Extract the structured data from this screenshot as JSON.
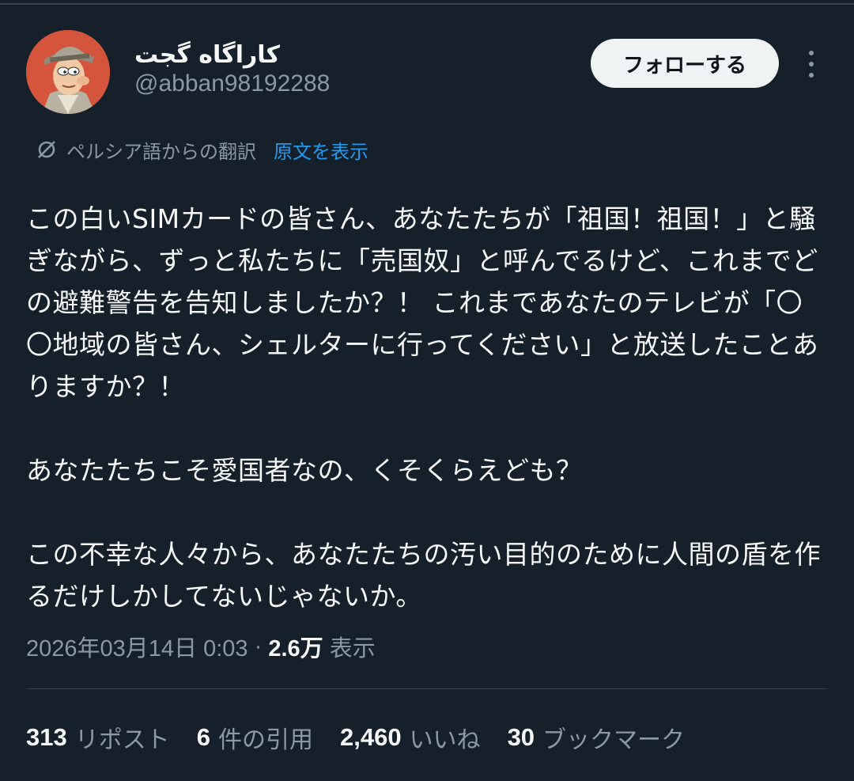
{
  "author": {
    "name": "کاراگاه گجت",
    "handle": "@abban98192288"
  },
  "follow_button_label": "フォローする",
  "translation": {
    "label": "ペルシア語からの翻訳",
    "show_original": "原文を表示"
  },
  "tweet": {
    "paragraphs": [
      "この白いSIMカードの皆さん、あなたたちが「祖国！祖国！」と騒ぎながら、ずっと私たちに「売国奴」と呼んでるけど、これまでどの避難警告を告知しましたか？！ これまであなたのテレビが「〇〇地域の皆さん、シェルターに行ってください」と放送したことありますか？！",
      "あなたたちこそ愛国者なの、くそくらえども？",
      "この不幸な人々から、あなたたちの汚い目的のために人間の盾を作るだけしかしてないじゃないか。"
    ]
  },
  "meta": {
    "timestamp": "2026年03月14日 0:03",
    "separator": " · ",
    "views_count": "2.6万",
    "views_label": " 表示"
  },
  "stats": {
    "reposts": {
      "count": "313",
      "label": "リポスト"
    },
    "quotes": {
      "count": "6",
      "label": "件の引用"
    },
    "likes": {
      "count": "2,460",
      "label": "いいね"
    },
    "bookmarks": {
      "count": "30",
      "label": "ブックマーク"
    }
  },
  "icons": {
    "more": "more-vertical-icon",
    "translate": "translate-icon"
  },
  "colors": {
    "background": "#15202b",
    "text": "#f7f9f9",
    "secondary": "#8b98a5",
    "link": "#1d9bf0",
    "divider": "#38444d",
    "button_bg": "#eff3f4"
  }
}
